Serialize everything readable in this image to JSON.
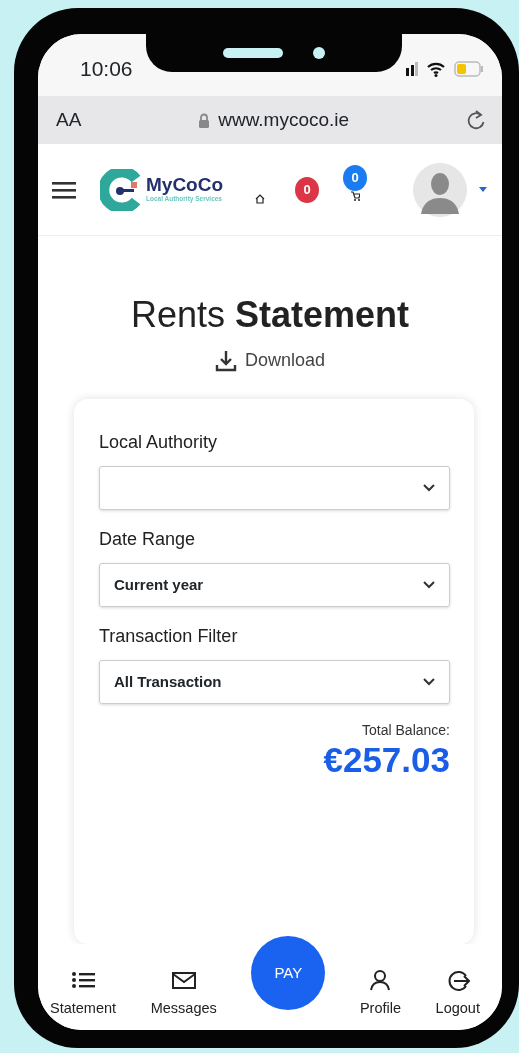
{
  "status_bar": {
    "time": "10:06"
  },
  "browser": {
    "text_size": "AA",
    "url": "www.mycoco.ie"
  },
  "header": {
    "logo_name": "MyCoCo",
    "logo_tagline": "Local Authority Services",
    "notification_count": "0",
    "cart_count": "0"
  },
  "page": {
    "title": "Rents **Statement**",
    "download": "Download"
  },
  "filters": [
    {
      "label": "Local Authority"
    },
    {
      "label": "Date Range",
      "value": "Current year"
    },
    {
      "label": "Transaction Filter",
      "value": "All Transaction"
    }
  ],
  "balance": {
    "label": "Total Balance:",
    "amount": "€257.03"
  },
  "bottom_nav": [
    {
      "kind": "list",
      "label": "Statement"
    },
    {
      "kind": "mail",
      "label": "Messages"
    },
    {
      "kind": "pay",
      "label": "PAY"
    },
    {
      "kind": "person",
      "label": "Profile"
    },
    {
      "kind": "logout",
      "label": "Logout"
    }
  ]
}
